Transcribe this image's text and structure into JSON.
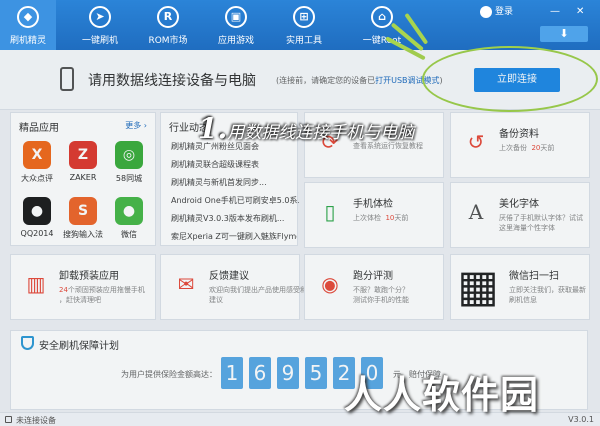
{
  "nav": {
    "items": [
      {
        "label": "刷机精灵",
        "icon": "shield-logo-icon",
        "glyph": "◆"
      },
      {
        "label": "一键刷机",
        "icon": "rocket-icon",
        "glyph": "➤"
      },
      {
        "label": "ROM市场",
        "icon": "rom-icon",
        "glyph": "R"
      },
      {
        "label": "应用游戏",
        "icon": "store-icon",
        "glyph": "▣"
      },
      {
        "label": "实用工具",
        "icon": "tools-icon",
        "glyph": "⊞"
      },
      {
        "label": "一键Root",
        "icon": "root-icon",
        "glyph": "⌂"
      }
    ],
    "login": "登录",
    "minimize": "—",
    "close": "✕",
    "download_glyph": "⬇"
  },
  "connect": {
    "title": "请用数据线连接设备与电脑",
    "note_prefix": "(连接前，请确定您的设备已",
    "note_link": "打开USB调试模式",
    "note_suffix": ")",
    "button": "立即连接"
  },
  "featured": {
    "title": "精品应用",
    "more": "更多 ›",
    "apps": [
      {
        "label": "大众点评",
        "glyph": "X",
        "color": "#f26a1b"
      },
      {
        "label": "ZAKER",
        "glyph": "Z",
        "color": "#e03a2f"
      },
      {
        "label": "58同城",
        "glyph": "◎",
        "color": "#3cae3c"
      },
      {
        "label": "QQ2014",
        "glyph": "●",
        "color": "#1d1d1d"
      },
      {
        "label": "搜狗输入法",
        "glyph": "S",
        "color": "#f0672a"
      },
      {
        "label": "微信",
        "glyph": "●",
        "color": "#48b848"
      }
    ]
  },
  "news": {
    "title": "行业动态",
    "items": [
      "刷机精灵广州粉丝见面会",
      "刷机精灵联合超级课程表",
      "刷机精灵与新机首发同步...",
      "Android One手机已可刷安卓5.0系...",
      "刷机精灵V3.0.3版本发布刷机...",
      "索尼Xperia Z可一键刷入魅族Flyme..."
    ]
  },
  "cards": {
    "repair": {
      "title": "",
      "sub": "查看系统运行恢复教程",
      "icon": "repair-icon",
      "glyph": "⟳"
    },
    "backup": {
      "title": "备份资料",
      "sub_prefix": "上次备份",
      "sub_days": "20",
      "sub_suffix": "天前",
      "icon": "backup-icon",
      "glyph": "↺"
    },
    "checkup": {
      "title": "手机体检",
      "sub_prefix": "上次体检",
      "sub_days": "10",
      "sub_suffix": "天前",
      "icon": "phone-check-icon",
      "glyph": "▯"
    },
    "font": {
      "title": "美化字体",
      "sub": "厌倦了手机默认字体？试试",
      "sub2": "这里海量个性字体",
      "icon": "font-icon",
      "glyph": "A"
    },
    "uninstall": {
      "title": "卸载预装应用",
      "sub_prefix": "24",
      "sub": "个顽固预装应用拖慢手机",
      "sub2": "，赶快清理吧",
      "icon": "trash-icon",
      "glyph": "🗑"
    },
    "feedback": {
      "title": "反馈建议",
      "sub": "欢迎向我们提出产品使用感受和",
      "sub2": "建议",
      "icon": "mail-icon",
      "glyph": "✉"
    },
    "benchmark": {
      "title": "跑分评测",
      "sub": "不服？敢跑个分？",
      "sub2": "测试你手机的性能",
      "icon": "benchmark-icon",
      "glyph": "◉"
    },
    "qrcode": {
      "title": "微信扫一扫",
      "sub": "立即关注我们，获取最新",
      "sub2": "刷机信息",
      "icon": "qrcode-icon",
      "glyph": "▦"
    }
  },
  "security": {
    "title": "安全刷机保障计划",
    "label": "为用户提供保险金额高达：",
    "digits": [
      "1",
      "6",
      "9",
      "5",
      "2",
      "0"
    ],
    "unit": "元，赔付保障"
  },
  "status": {
    "text": "未连接设备",
    "version": "V3.0.1"
  },
  "overlay": {
    "annotation_num": "1.",
    "annotation_text": "用数据线连接手机与电脑",
    "watermark": "人人软件园"
  },
  "colors": {
    "brand_blue": "#1f6dc0",
    "button_blue": "#1f8ae6",
    "highlight_green": "#9fd04a",
    "accent_red": "#e84a3a"
  }
}
